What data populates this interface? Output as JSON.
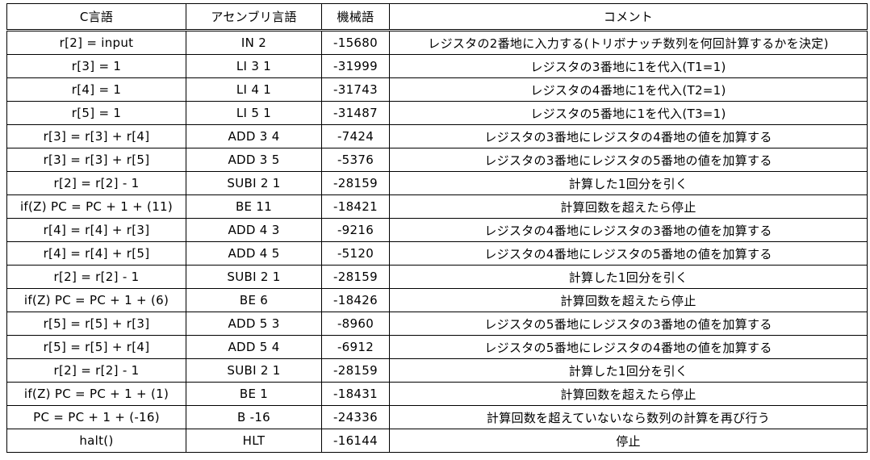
{
  "headers": [
    "C言語",
    "アセンブリ言語",
    "機械語",
    "コメント"
  ],
  "rows": [
    {
      "c": "r[2] = input",
      "asm": "IN 2",
      "machine": "-15680",
      "comment": "レジスタの2番地に入力する(トリボナッチ数列を何回計算するかを決定)"
    },
    {
      "c": "r[3] = 1",
      "asm": "LI 3 1",
      "machine": "-31999",
      "comment": "レジスタの3番地に1を代入(T1=1)"
    },
    {
      "c": "r[4] = 1",
      "asm": "LI 4 1",
      "machine": "-31743",
      "comment": "レジスタの4番地に1を代入(T2=1)"
    },
    {
      "c": "r[5] = 1",
      "asm": "LI 5 1",
      "machine": "-31487",
      "comment": "レジスタの5番地に1を代入(T3=1)"
    },
    {
      "c": "r[3] = r[3] + r[4]",
      "asm": "ADD 3 4",
      "machine": "-7424",
      "comment": "レジスタの3番地にレジスタの4番地の値を加算する"
    },
    {
      "c": "r[3] = r[3] + r[5]",
      "asm": "ADD 3 5",
      "machine": "-5376",
      "comment": "レジスタの3番地にレジスタの5番地の値を加算する"
    },
    {
      "c": "r[2] = r[2] - 1",
      "asm": "SUBI 2 1",
      "machine": "-28159",
      "comment": "計算した1回分を引く"
    },
    {
      "c": "if(Z) PC = PC + 1 + (11)",
      "asm": "BE 11",
      "machine": "-18421",
      "comment": "計算回数を超えたら停止"
    },
    {
      "c": "r[4] = r[4] + r[3]",
      "asm": "ADD 4 3",
      "machine": "-9216",
      "comment": "レジスタの4番地にレジスタの3番地の値を加算する"
    },
    {
      "c": "r[4] = r[4] + r[5]",
      "asm": "ADD 4 5",
      "machine": "-5120",
      "comment": "レジスタの4番地にレジスタの5番地の値を加算する"
    },
    {
      "c": "r[2] = r[2] - 1",
      "asm": "SUBI 2 1",
      "machine": "-28159",
      "comment": "計算した1回分を引く"
    },
    {
      "c": "if(Z) PC = PC + 1 + (6)",
      "asm": "BE 6",
      "machine": "-18426",
      "comment": "計算回数を超えたら停止"
    },
    {
      "c": "r[5] = r[5] + r[3]",
      "asm": "ADD 5 3",
      "machine": "-8960",
      "comment": "レジスタの5番地にレジスタの3番地の値を加算する"
    },
    {
      "c": "r[5] = r[5] + r[4]",
      "asm": "ADD 5 4",
      "machine": "-6912",
      "comment": "レジスタの5番地にレジスタの4番地の値を加算する"
    },
    {
      "c": "r[2] = r[2] - 1",
      "asm": "SUBI 2 1",
      "machine": "-28159",
      "comment": "計算した1回分を引く"
    },
    {
      "c": "if(Z) PC = PC + 1 + (1)",
      "asm": "BE 1",
      "machine": "-18431",
      "comment": "計算回数を超えたら停止"
    },
    {
      "c": "PC = PC + 1 + (-16)",
      "asm": "B -16",
      "machine": "-24336",
      "comment": "計算回数を超えていないなら数列の計算を再び行う"
    },
    {
      "c": "halt()",
      "asm": "HLT",
      "machine": "-16144",
      "comment": "停止"
    }
  ]
}
